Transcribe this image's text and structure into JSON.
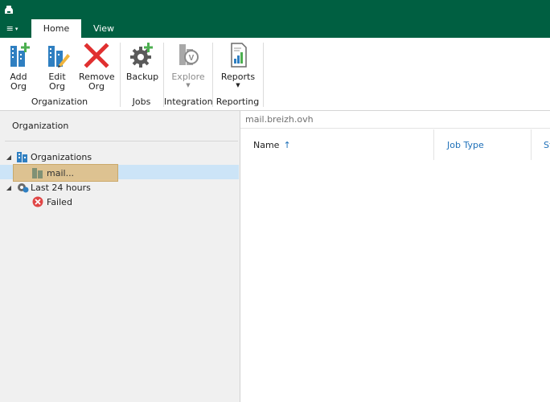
{
  "tabs": {
    "menu": "≡",
    "home": "Home",
    "view": "View"
  },
  "ribbon": {
    "add_org": [
      "Add",
      "Org"
    ],
    "edit_org": [
      "Edit",
      "Org"
    ],
    "remove_org": [
      "Remove",
      "Org"
    ],
    "backup": "Backup",
    "explore": "Explore",
    "reports": "Reports",
    "groups": {
      "organization": "Organization",
      "jobs": "Jobs",
      "integration": "Integration",
      "reporting": "Reporting"
    }
  },
  "left_pane": {
    "title": "Organization",
    "tree": {
      "organizations": "Organizations",
      "mail_item": "mail...",
      "last24": "Last 24 hours",
      "failed": "Failed"
    }
  },
  "right_pane": {
    "path": "mail.breizh.ovh",
    "columns": {
      "name": "Name",
      "sort_arrow": "↑",
      "job_type": "Job Type",
      "st": "St"
    }
  },
  "colors": {
    "accent": "#005f41",
    "link": "#1d6fb8",
    "selection": "#cce4f7",
    "drag": "#dfc089"
  }
}
